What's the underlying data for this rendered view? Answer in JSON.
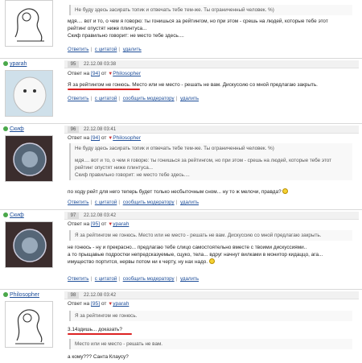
{
  "actions": {
    "reply": "Ответить",
    "quote": "с цитатой",
    "report": "сообщить модератору",
    "delete": "удалить"
  },
  "top_post": {
    "quote": "Не буду здесь засирать топик и отвечать тебе тем-же. Ты ограниченный человек. %)",
    "text_lines": [
      "мдя.... вот и то, о чем я говорю: ты гонишься за рейтингом, но при этом - срешь на людей, которые тебе этот",
      "рейтинг опустят ниже плинтуса...",
      "Скиф правильно говорит: не место тебе здесь...."
    ]
  },
  "posts": [
    {
      "username": "yparah",
      "num": "95",
      "date": "22.12.08 03:38",
      "reply_prefix": "Ответ на",
      "reply_num": "[94]",
      "reply_word": "от",
      "reply_user": "Philosopher",
      "text": "Я за рейтингом не гонюсь. Место или не место - решать не вам. Дискуссию со мной предлагаю закрыть."
    },
    {
      "username": "Скиф",
      "num": "96",
      "date": "22.12.08 03:41",
      "reply_prefix": "Ответ на",
      "reply_num": "[94]",
      "reply_word": "от",
      "reply_user": "Philosopher",
      "quote1": "Не буду здесь засирать топик и отвечать тебе тем-же. Ты ограниченный человек. %)",
      "quote2_lines": [
        "мдя.... вот и то, о чем я говорю: ты гонишься за рейтингом, но при этом - срешь на людей, которые тебе этот",
        "рейтинг опустят ниже плинтуса...",
        "Скиф правильно говорит: не место тебе здесь...."
      ],
      "text": "по ходу рейт для него теперь будет только несбыточным сном... ну то ж мелочи, правда?"
    },
    {
      "username": "Скиф",
      "num": "97",
      "date": "22.12.08 03:42",
      "reply_prefix": "Ответ на",
      "reply_num": "[95]",
      "reply_word": "от",
      "reply_user": "yparah",
      "quote": "Я за рейтингом не гонюсь. Место или не место - решать не вам. Дискуссию со мной предлагаю закрыть.",
      "text_lines": [
        "не гонюсь - ну и прекрасно... предлагаю тебе слицо самостоятельно вместе с твоими дискуссиями..",
        "а то прыщавые подростки непредсказуемые, сцуко, тела... вдруг начнут вилками в монитор кидаццо, ага...",
        "имущество портится, нервы потом ни к черту, ну нах надо."
      ]
    },
    {
      "username": "Philosopher",
      "num": "98",
      "date": "22.12.08 03:42",
      "reply_prefix": "Ответ на",
      "reply_num": "[95]",
      "reply_word": "от",
      "reply_user": "yparah",
      "quote1": "Я за рейтингом не гонюсь.",
      "text1": "3.14здишь... доказать?",
      "quote2": "Место или не место - решать не вам.",
      "text2": "а кому??? Санта Клаусу?"
    }
  ]
}
